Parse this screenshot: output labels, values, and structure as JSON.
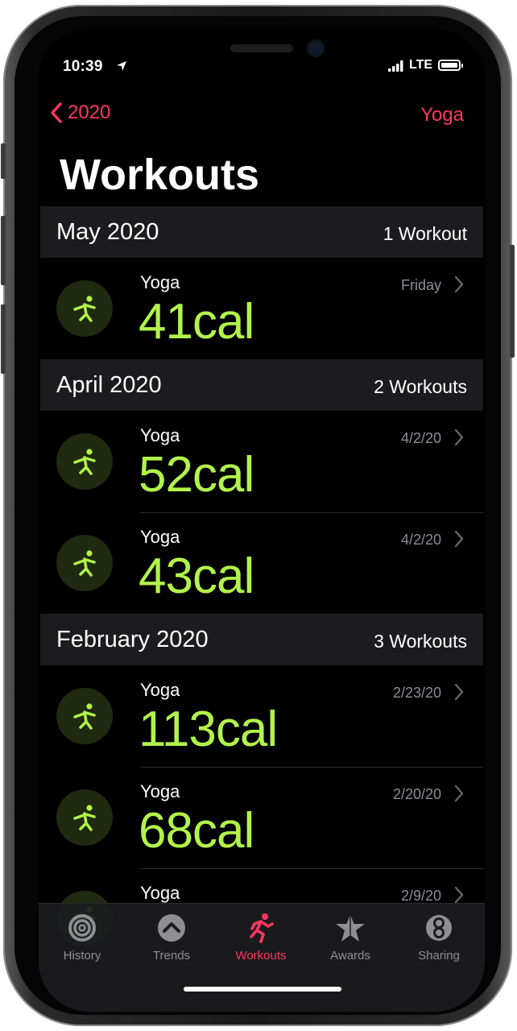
{
  "status_bar": {
    "time": "10:39",
    "network": "LTE",
    "icons": [
      "location-arrow-icon",
      "signal-bars-icon",
      "battery-icon"
    ]
  },
  "nav": {
    "back_label": "2020",
    "filter_label": "Yoga",
    "title": "Workouts"
  },
  "sections": [
    {
      "month": "May 2020",
      "count": "1 Workout",
      "workouts": [
        {
          "type": "Yoga",
          "calories": "41cal",
          "date": "Friday"
        }
      ]
    },
    {
      "month": "April 2020",
      "count": "2 Workouts",
      "workouts": [
        {
          "type": "Yoga",
          "calories": "52cal",
          "date": "4/2/20"
        },
        {
          "type": "Yoga",
          "calories": "43cal",
          "date": "4/2/20"
        }
      ]
    },
    {
      "month": "February 2020",
      "count": "3 Workouts",
      "workouts": [
        {
          "type": "Yoga",
          "calories": "113cal",
          "date": "2/23/20"
        },
        {
          "type": "Yoga",
          "calories": "68cal",
          "date": "2/20/20"
        },
        {
          "type": "Yoga",
          "calories": "",
          "date": "2/9/20"
        }
      ]
    }
  ],
  "tabs": [
    {
      "label": "History",
      "icon": "history-rings-icon",
      "active": false
    },
    {
      "label": "Trends",
      "icon": "trends-chevron-icon",
      "active": false
    },
    {
      "label": "Workouts",
      "icon": "running-figure-icon",
      "active": true
    },
    {
      "label": "Awards",
      "icon": "award-star-icon",
      "active": false
    },
    {
      "label": "Sharing",
      "icon": "sharing-icon",
      "active": false
    }
  ],
  "colors": {
    "accent": "#ff375f",
    "calories": "#b2f34a",
    "section_bg": "#1c1c1e",
    "secondary_text": "#8e8e93"
  }
}
